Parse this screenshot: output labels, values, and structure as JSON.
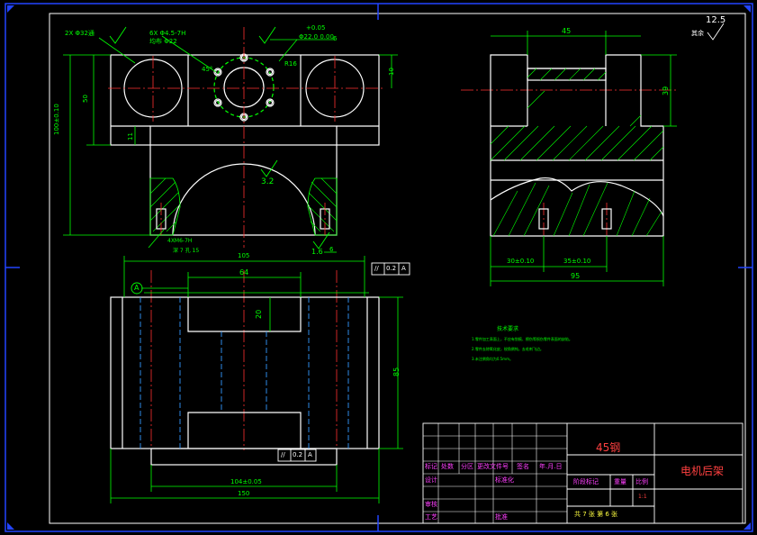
{
  "border": {
    "frame_color": "#2244ff",
    "line_color": "#ffffff",
    "dim_color": "#00ff00",
    "center_color": "#ff3030",
    "hidden_color": "#3399ff"
  },
  "surface_finish": {
    "general": "12.5",
    "suffix": "其余"
  },
  "front_view": {
    "callouts": {
      "holes_top": "2X Φ32通",
      "thread_holes": "6X Φ4.5-7H",
      "pcd": "均布 Φ22",
      "bore_tol": "+0.05",
      "bore_dia": "Φ22.0 0.00",
      "radius": "R16",
      "angle": "45°",
      "finish_a": "6",
      "finish_b": "3.2",
      "finish_c": "1.6",
      "thread_bottom": "4XM6-7H",
      "thread_depth": "深 7 孔 15",
      "dim_h_total": "100±0.10",
      "dim_50": "50",
      "dim_11": "11",
      "dim_10": "10",
      "dim_6": "6"
    }
  },
  "side_view": {
    "dim_45": "45",
    "dim_39": "39",
    "dim_30": "30±0.10",
    "dim_35": "35±0.10",
    "dim_95": "95"
  },
  "plan_view": {
    "datum": "A",
    "dim_105": "105",
    "dim_64": "64",
    "dim_20": "20",
    "dim_85": "85",
    "dim_104": "104±0.05",
    "dim_150": "150",
    "tol_parallel_top": {
      "symbol": "//",
      "value": "0.2",
      "datum": "A"
    },
    "tol_parallel_bottom": {
      "symbol": "//",
      "value": "0.2",
      "datum": "A"
    }
  },
  "notes": {
    "title": "技术要求",
    "items": [
      "1.零件加工表面上，不应有划痕、擦伤等损伤零件表面的缺陷。",
      "2.零件去除氧化皮，锐角倒钝，去毛刺飞边。",
      "3.未注倒角均为0.5mm。"
    ]
  },
  "title_block": {
    "material": "45钢",
    "drawing_name": "电机后架",
    "scale_value": "1:1",
    "sheet_info": "共 7 张 第 6 张",
    "headers": [
      "标记",
      "处数",
      "分区",
      "更改文件号",
      "签名",
      "年.月.日"
    ],
    "left_labels": [
      "设计",
      "审核",
      "工艺"
    ],
    "mid_labels": [
      "标准化",
      "批准"
    ],
    "stage_labels": [
      "阶段标记",
      "重量",
      "比例"
    ]
  }
}
